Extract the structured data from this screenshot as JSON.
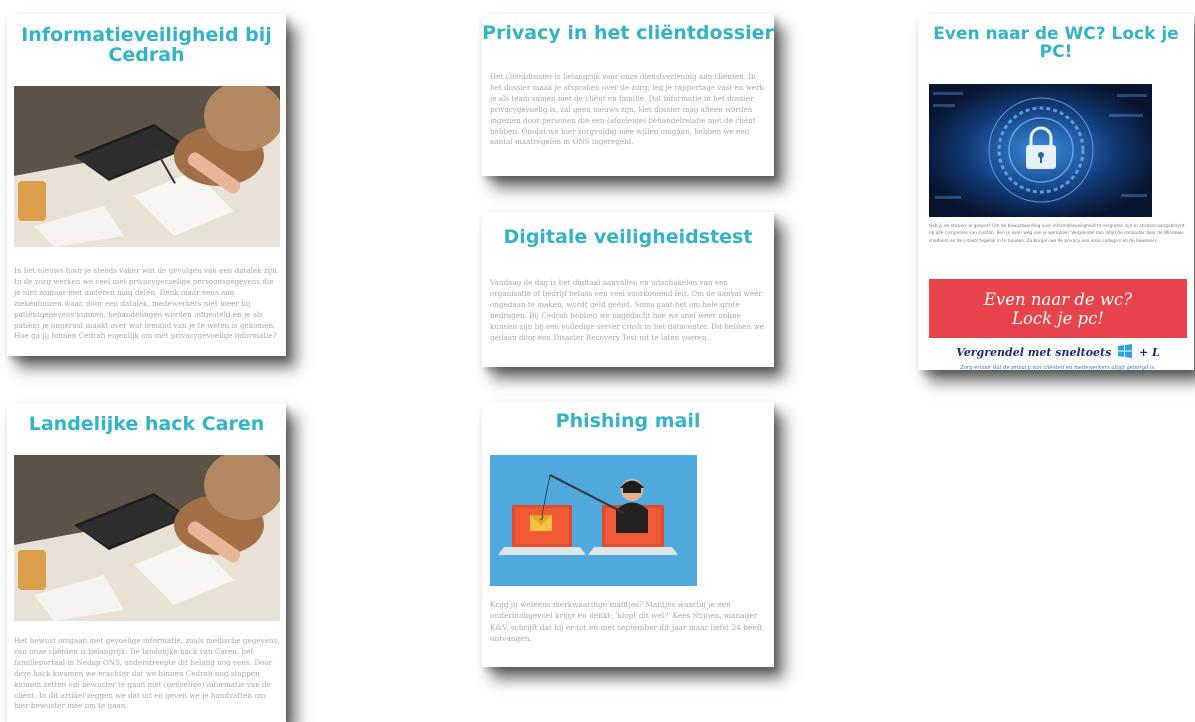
{
  "cards": {
    "info": {
      "title": "Informatieveiligheid bij Cedrah",
      "body": "In het nieuws hoor je steeds vaker wat de gevolgen van een datalek zijn. In de zorg werken we veel met privacygevoelige persoonsgegevens die je niet zomaar met anderen mag delen. Denk maar eens aan ziekenhuizen waar, door een datalek, medewerkers niet meer bij patiëntgegevens kunnen, behandelingen worden uitgesteld en je als patiënt je ongerust maakt over wat iemand van je te weten is gekomen. Hoe ga jij binnen Cedrah eigenlijk om met privacygevoelige informatie?"
    },
    "hack": {
      "title": "Landelijke hack Caren",
      "body": "Het bewust omgaan met gevoelige informatie, zoals medische gegevens, van onze cliënten is belangrijk. De landelijke hack van Caren, het familieportaal in Nedap ONS, onderstreepte dit belang nog eens. Door deze hack kwamen we erachter dat we binnen Cedrah nog stappen kunnen zetten om bewuster te gaan met (gevoelige) informatie van de cliënt. In dit artikel zeggen we dat uit en geven we je handvatten om hier bewuster mee om te gaan."
    },
    "privacy": {
      "title": "Privacy in het cliëntdossier",
      "body": "Het cliëntdossier is belangrijk voor onze dienstverlening aan cliënten. In het dossier maak je afspraken over de zorg, leg je rapportage vast en werk je als team samen met de cliënt en familie. Dat informatie in het dossier privacygevoelig is, zal geen nieuws zijn. Het dossier mag alleen worden ingezien door personen die een (afgeleide) behandelrelatie met de cliënt hebben. Omdat we hier zorgvuldig mee willen omgaan, hebben we een aantal maatregelen in ONS ingeregeld."
    },
    "test": {
      "title": "Digitale veiligheidstest",
      "body": "Vandaag de dag is het digitaal aanvallen en uitschakelen van een organisatie of bedrijf helaas een veel voorkomend feit. Om de aanval weer ongedaan te maken, wordt geld geëist. Soms gaat het om hele grote bedragen. Bij Cedrah hebben we nagedacht hoe we snel weer online kunnen zijn bij een volledige server crash in het datacenter. Dit hebben we gedaan door een Disaster Recovery Test uit te laten voeren."
    },
    "phishing": {
      "title": "Phishing mail",
      "body": "Krijg jij weleens merkwaardige mailtjes? Mailtjes waarbij je een onderbuikgevoel krijgt en denkt: 'klopt dit wel?' Kees Stijnen, manager K&V, schrijft dat hij er tot en met september dit jaar maar liefst 24 heeft ontvangen."
    },
    "lock": {
      "title": "Even naar de WC? Lock je PC!",
      "body": "Heb jij de stickers al gespot? Om de bewustwording over informatieveiligheid te vergroten zijn er stickers aangebracht op alle computers van Cedrah. Ben je even weg van je werkplek? Vergrendel dan altijd de computer door de Windows-sneltoets en de L-toets tegelijk in te houden. Zo borgen we de privacy van onze collega's en de bewoners.",
      "banner_line1": "Even naar de wc?",
      "banner_line2": "Lock je pc!",
      "shortcut_prefix": "Vergrendel met sneltoets",
      "shortcut_suffix": "+ L",
      "footer": "Zorg ervoor dat de privacy van cliënten en medewerkers altijd geborgd is."
    }
  },
  "colors": {
    "title": "#33b3c7",
    "banner": "#e8434a",
    "shortcut": "#1a2a80",
    "phishing_bg": "#4fa9dc"
  },
  "icons": [
    "desk-photo",
    "phishing-illustration",
    "padlock-icon",
    "windows-logo-icon"
  ]
}
